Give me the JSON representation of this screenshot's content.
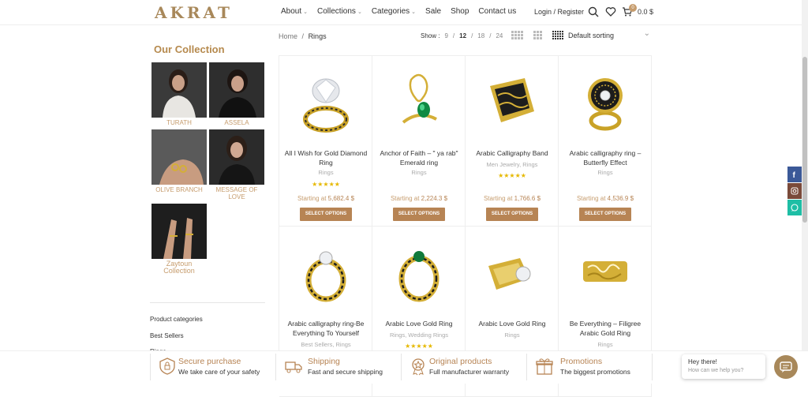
{
  "header": {
    "logo": "AKRAT",
    "nav": [
      {
        "label": "About",
        "dropdown": true
      },
      {
        "label": "Collections",
        "dropdown": true
      },
      {
        "label": "Categories",
        "dropdown": true
      },
      {
        "label": "Sale",
        "dropdown": false
      },
      {
        "label": "Shop",
        "dropdown": false
      },
      {
        "label": "Contact us",
        "dropdown": false
      }
    ],
    "login": "Login / Register",
    "cart_count": "0",
    "cart_total": "0.0 $"
  },
  "sidebar": {
    "title": "Our Collection",
    "collections": [
      "TURATH",
      "ASSELA",
      "OLIVE BRANCH",
      "MESSAGE OF LOVE",
      "Zaytoun Collection"
    ],
    "links": [
      "Product categories",
      "Best Sellers",
      "Rings"
    ]
  },
  "toolbar": {
    "breadcrumb_home": "Home",
    "breadcrumb_sep": "/",
    "breadcrumb_current": "Rings",
    "show_label": "Show :",
    "show_options": [
      "9",
      "12",
      "18",
      "24"
    ],
    "show_current": "12",
    "sort": "Default sorting"
  },
  "products": [
    {
      "title": "All I Wish for Gold Diamond Ring",
      "cat": "Rings",
      "stars": "★★★★★",
      "price_label": "Starting at",
      "price": "5,682.4 $",
      "button": "SELECT OPTIONS"
    },
    {
      "title": "Anchor of Faith – \" ya rab\" Emerald ring",
      "cat": "Rings",
      "stars": "",
      "price_label": "Starting at",
      "price": "2,224.3 $",
      "button": "SELECT OPTIONS"
    },
    {
      "title": "Arabic Calligraphy Band",
      "cat": "Men Jewelry, Rings",
      "stars": "★★★★★",
      "price_label": "Starting at",
      "price": "1,766.6 $",
      "button": "SELECT OPTIONS"
    },
    {
      "title": "Arabic calligraphy ring – Butterfly Effect",
      "cat": "Rings",
      "stars": "",
      "price_label": "Starting at",
      "price": "4,536.9 $",
      "button": "SELECT OPTIONS"
    },
    {
      "title": "Arabic calligraphy ring-Be Everything To Yourself",
      "cat": "Best Sellers, Rings",
      "stars": "",
      "price_label": "",
      "price": "",
      "button": ""
    },
    {
      "title": "Arabic Love Gold Ring",
      "cat": "Rings, Wedding Rings",
      "stars": "★★★★★",
      "price_label": "",
      "price": "",
      "button": ""
    },
    {
      "title": "Arabic Love Gold Ring",
      "cat": "Rings",
      "stars": "",
      "price_label": "",
      "price": "",
      "button": ""
    },
    {
      "title": "Be Everything – Filigree Arabic Gold Ring",
      "cat": "Rings",
      "stars": "",
      "price_label": "",
      "price": "",
      "button": ""
    }
  ],
  "features": [
    {
      "title": "Secure purchase",
      "sub": "We take care of your safety",
      "icon": "shield-lock-icon"
    },
    {
      "title": "Shipping",
      "sub": "Fast and secure shipping",
      "icon": "truck-icon"
    },
    {
      "title": "Original products",
      "sub": "Full manufacturer warranty",
      "icon": "medal-icon"
    },
    {
      "title": "Promotions",
      "sub": "The biggest promotions",
      "icon": "gift-icon"
    }
  ],
  "chat": {
    "greeting": "Hey there!",
    "prompt": "How can we help you?"
  },
  "colors": {
    "accent": "#c69c6d",
    "button": "#b78454",
    "facebook": "#3b5998",
    "instagram": "#7a4a3a",
    "whatsapp": "#1ebea5"
  }
}
